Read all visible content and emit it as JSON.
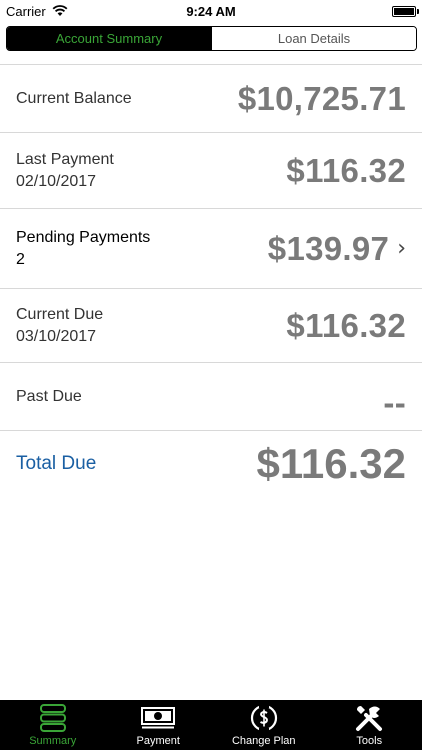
{
  "status_bar": {
    "carrier": "Carrier",
    "time": "9:24 AM",
    "battery_level": 1.0
  },
  "segmented": {
    "tab1": "Account Summary",
    "tab2": "Loan Details"
  },
  "rows": {
    "current_balance": {
      "label": "Current Balance",
      "value": "$10,725.71"
    },
    "last_payment": {
      "label": "Last Payment",
      "date": "02/10/2017",
      "value": "$116.32"
    },
    "pending_payments": {
      "label": "Pending Payments",
      "count": "2",
      "value": "$139.97"
    },
    "current_due": {
      "label": "Current Due",
      "date": "03/10/2017",
      "value": "$116.32"
    },
    "past_due": {
      "label": "Past Due",
      "value": "--"
    },
    "total_due": {
      "label": "Total Due",
      "value": "$116.32"
    }
  },
  "tabbar": {
    "summary": "Summary",
    "payment": "Payment",
    "change_plan": "Change Plan",
    "tools": "Tools"
  },
  "colors": {
    "accent_green": "#3aa537",
    "total_blue": "#1a5fa3",
    "value_gray": "#7a7a7a"
  }
}
